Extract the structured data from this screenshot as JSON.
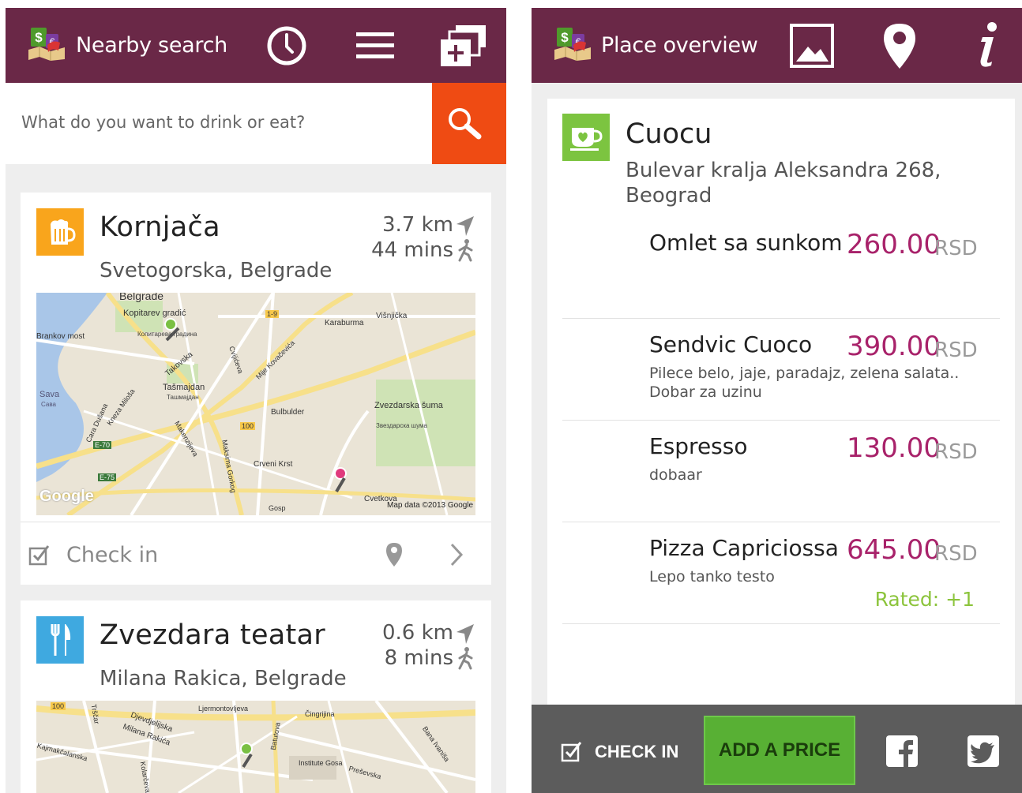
{
  "nearby": {
    "title": "Nearby search",
    "search_placeholder": "What do you want to drink or eat?",
    "places": [
      {
        "name": "Kornjača",
        "address": "Svetogorska, Belgrade",
        "distance": "3.7 km",
        "walk_time": "44 mins",
        "category_icon": "beer-mug-icon",
        "category_color": "#f9a51c",
        "map_labels": [
          "Belgrade",
          "Kopitarev gradić",
          "Копитарева градина",
          "Brankov most",
          "Karaburma",
          "Višnjička",
          "Takovska",
          "Tašmajdan",
          "Ташмајдан",
          "Sava",
          "Сава",
          "Cvijićeva",
          "Mije Kovačevića",
          "Bulbulder",
          "Zvezdarska šuma",
          "Звездарска шума",
          "Cvetkova",
          "Crveni Krst",
          "Makenzijeva",
          "Maksima Gorkog",
          "Kneza Miloša",
          "Cara Dušana",
          "E-70",
          "E-75",
          "1-9",
          "100",
          "Gosp",
          "Map data ©2013 Google",
          "Google"
        ],
        "checkin_label": "Check in"
      },
      {
        "name": "Zvezdara teatar",
        "address": "Milana Rakica, Belgrade",
        "distance": "0.6 km",
        "walk_time": "8 mins",
        "category_icon": "fork-knife-icon",
        "category_color": "#3fa9e0",
        "map_labels": [
          "100",
          "Trščar",
          "Djevdjelijska",
          "Milana Rakića",
          "Čingrijina",
          "Batutova",
          "Kajmakčalanska",
          "Institute Gosa",
          "Preševska",
          "Bana Ivaniša",
          "Ljermontovljeva",
          "Kolarčeva"
        ]
      }
    ]
  },
  "overview": {
    "title": "Place overview",
    "place_name": "Cuocu",
    "place_address": "Bulevar kralja Aleksandra 268, Beograd",
    "category_icon": "coffee-cup-icon",
    "category_color": "#7cc440",
    "items": [
      {
        "name": "Omlet sa sunkom",
        "price": "260.00",
        "currency": "RSD",
        "description": "",
        "rating": ""
      },
      {
        "name": "Sendvic Cuoco",
        "price": "390.00",
        "currency": "RSD",
        "description": "Pilece belo, jaje, paradajz, zelena salata.. Dobar za uzinu",
        "rating": ""
      },
      {
        "name": "Espresso",
        "price": "130.00",
        "currency": "RSD",
        "description": "dobaar",
        "rating": ""
      },
      {
        "name": "Pizza Capriciossa",
        "price": "645.00",
        "currency": "RSD",
        "description": "Lepo tanko testo",
        "rating": "Rated: +1"
      }
    ],
    "checkin_label": "CHECK IN",
    "add_price_label": "ADD A PRICE"
  },
  "colors": {
    "action_bar": "#6a2847",
    "search_button": "#ef4b13",
    "price": "#a8226a",
    "rated": "#8cc43c",
    "add_price_button": "#58b034",
    "bottom_bar": "#5c5c5c"
  }
}
